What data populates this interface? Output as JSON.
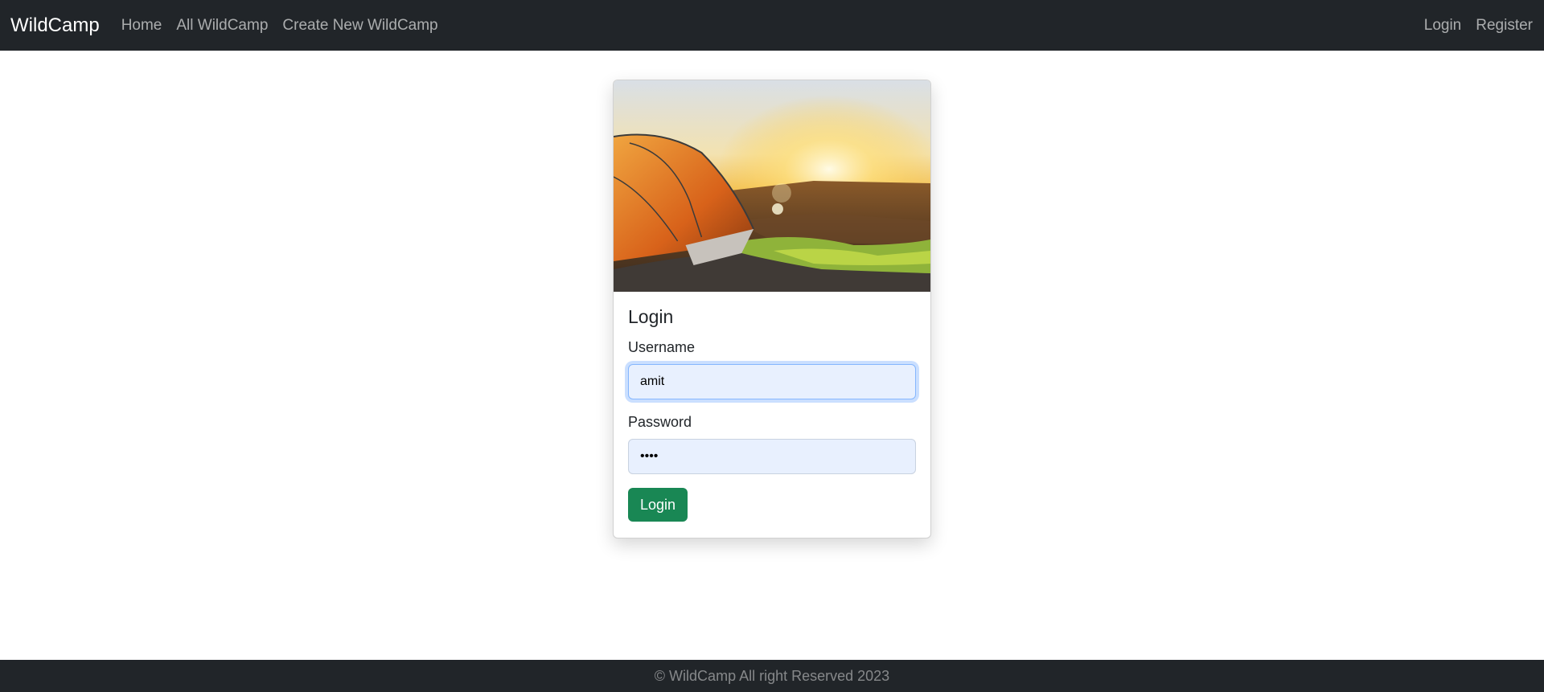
{
  "navbar": {
    "brand": "WildCamp",
    "links": [
      "Home",
      "All WildCamp",
      "Create New WildCamp"
    ],
    "right_links": [
      "Login",
      "Register"
    ]
  },
  "login_card": {
    "image_alt": "tent-at-sunset-photo",
    "title": "Login",
    "username_label": "Username",
    "username_value": "amit",
    "password_label": "Password",
    "password_value": "••••",
    "button_label": "Login"
  },
  "footer": {
    "text": "© WildCamp All right Reserved 2023"
  },
  "colors": {
    "navbar_bg": "#212529",
    "button_bg": "#198754",
    "input_bg": "#e8f0fe"
  }
}
